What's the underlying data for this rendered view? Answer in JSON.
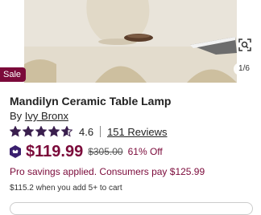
{
  "product_image": {
    "visual_search_icon": "visual-search-icon",
    "counter": "1/6",
    "sale_badge": "Sale"
  },
  "product": {
    "title": "Mandilyn Ceramic Table Lamp",
    "by_label": "By",
    "brand": "Ivy Bronx",
    "rating": 4.6,
    "rating_text": "4.6",
    "reviews": "151 Reviews",
    "price": "$119.99",
    "original_price": "$305.00",
    "discount": "61% Off",
    "pro_savings": "Pro savings applied. Consumers pay $125.99",
    "bulk_note": "$115.2 when you add 5+ to cart"
  },
  "colors": {
    "accent": "#7b0a3a",
    "star": "#3a1f4e",
    "text": "#222222"
  }
}
